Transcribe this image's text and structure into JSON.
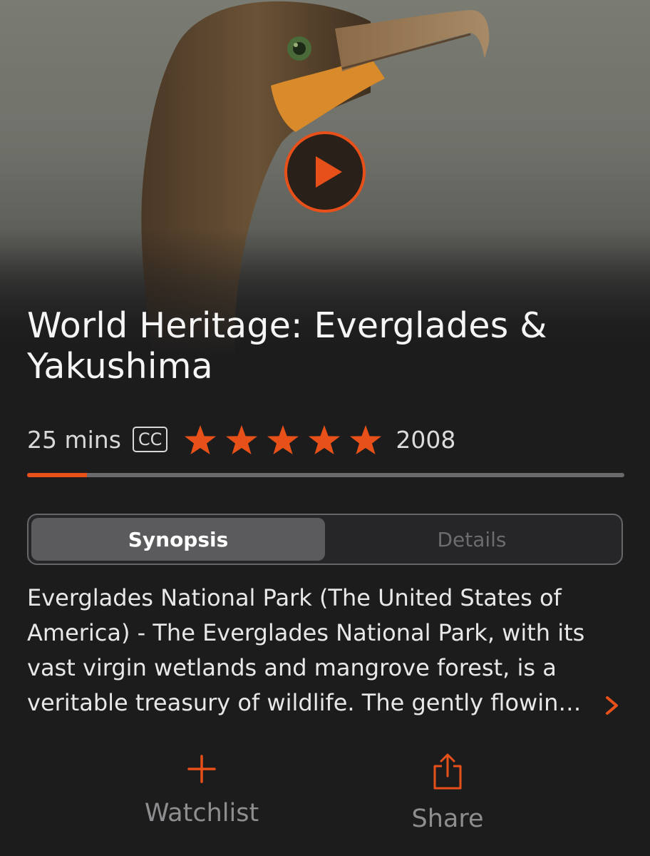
{
  "program": {
    "title": "World Heritage: Everglades & Yakushima",
    "duration": "25 mins",
    "cc_label": "CC",
    "rating_stars": 5,
    "year": "2008",
    "watch_progress": 0.1
  },
  "tabs": [
    {
      "label": "Synopsis",
      "active": true
    },
    {
      "label": "Details",
      "active": false
    }
  ],
  "synopsis": {
    "text": "Everglades National Park (The United States of America) - The Everglades National Park, with its vast virgin wetlands and mangrove forest, is a veritable treasury of wildlife. The gently flowin…",
    "more_icon": "chevron-right-icon"
  },
  "actions": {
    "watchlist_label": "Watchlist",
    "watchlist_icon": "plus-icon",
    "share_label": "Share",
    "share_icon": "share-icon"
  },
  "hero": {
    "play_icon": "play-icon"
  },
  "colors": {
    "accent": "#e8501a",
    "background": "#1c1c1d",
    "inactive_text": "#8e8e90"
  }
}
